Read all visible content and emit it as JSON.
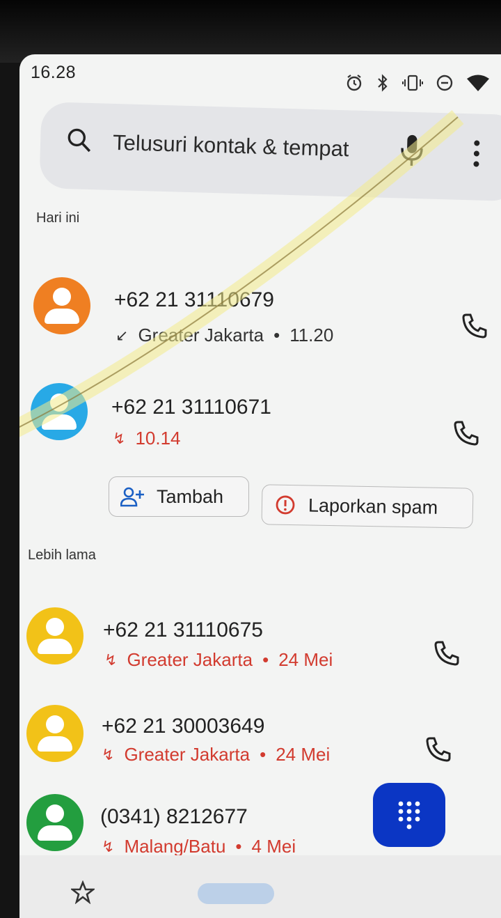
{
  "status_bar": {
    "time": "16.28"
  },
  "search": {
    "placeholder": "Telusuri kontak & tempat"
  },
  "sections": {
    "today": "Hari ini",
    "older": "Lebih lama"
  },
  "calls": [
    {
      "number": "+62 21 31110679",
      "location": "Greater Jakarta",
      "time": "11.20",
      "type": "incoming",
      "avatar_color": "#ef7f22"
    },
    {
      "number": "+62 21 31110671",
      "location": "",
      "time": "10.14",
      "type": "missed",
      "avatar_color": "#28a9e6"
    },
    {
      "number": "+62 21 31110675",
      "location": "Greater Jakarta",
      "time": "24 Mei",
      "type": "missed",
      "avatar_color": "#f2c218"
    },
    {
      "number": "+62 21 30003649",
      "location": "Greater Jakarta",
      "time": "24 Mei",
      "type": "missed",
      "avatar_color": "#f2c218"
    },
    {
      "number": "(0341) 8212677",
      "location": "Malang/Batu",
      "time": "4 Mei",
      "type": "missed",
      "avatar_color": "#239e3f"
    }
  ],
  "actions": {
    "add_label": "Tambah",
    "spam_label": "Laporkan spam"
  },
  "separator": "•",
  "colors": {
    "missed": "#d23b2f",
    "normal_text": "#333333",
    "fab": "#0b36c4"
  }
}
